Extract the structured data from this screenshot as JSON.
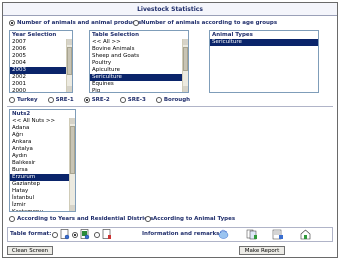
{
  "window": {
    "title": "Livestock Statistics"
  },
  "mode": {
    "option_products": "Number of animals and animal products",
    "option_age_groups": "Number of animals according to age groups",
    "selected": "products"
  },
  "year_list": {
    "header": "Year Selection",
    "items": [
      "2007",
      "2006",
      "2005",
      "2004",
      "2003",
      "2002",
      "2001",
      "2000"
    ],
    "selected": "2003"
  },
  "table_list": {
    "header": "Table Selection",
    "items": [
      "<< All >>",
      "Bovine Animals",
      "Sheep and Goats",
      "Poultry",
      "Apiculture",
      "Sericulture",
      "Equines",
      "Pig"
    ],
    "selected": "Sericulture"
  },
  "animal_types": {
    "header": "Animal Types",
    "items": [
      "Sericulture"
    ],
    "selected": "Sericulture"
  },
  "region_level": {
    "options": [
      "Turkey",
      "SRE-1",
      "SRE-2",
      "SRE-3",
      "Borough"
    ],
    "selected": "SRE-2"
  },
  "nuts_list": {
    "header": "Nuts2",
    "items": [
      "<< All Nuts >>",
      "Adana",
      "Ağrı",
      "Ankara",
      "Antalya",
      "Aydın",
      "Balıkesir",
      "Bursa",
      "Erzurum",
      "Gaziantep",
      "Hatay",
      "İstanbul",
      "İzmir",
      "Kastamonu"
    ],
    "selected": "Erzurum"
  },
  "grouping": {
    "option_years_districts": "According to Years and Residential Districts",
    "option_animal_types": "According to Animal Types"
  },
  "format_bar": {
    "table_format_label": "Table format:",
    "info_label": "Information and remarks:"
  },
  "buttons": {
    "clean": "Clean Screen",
    "make_report": "Make Report"
  }
}
